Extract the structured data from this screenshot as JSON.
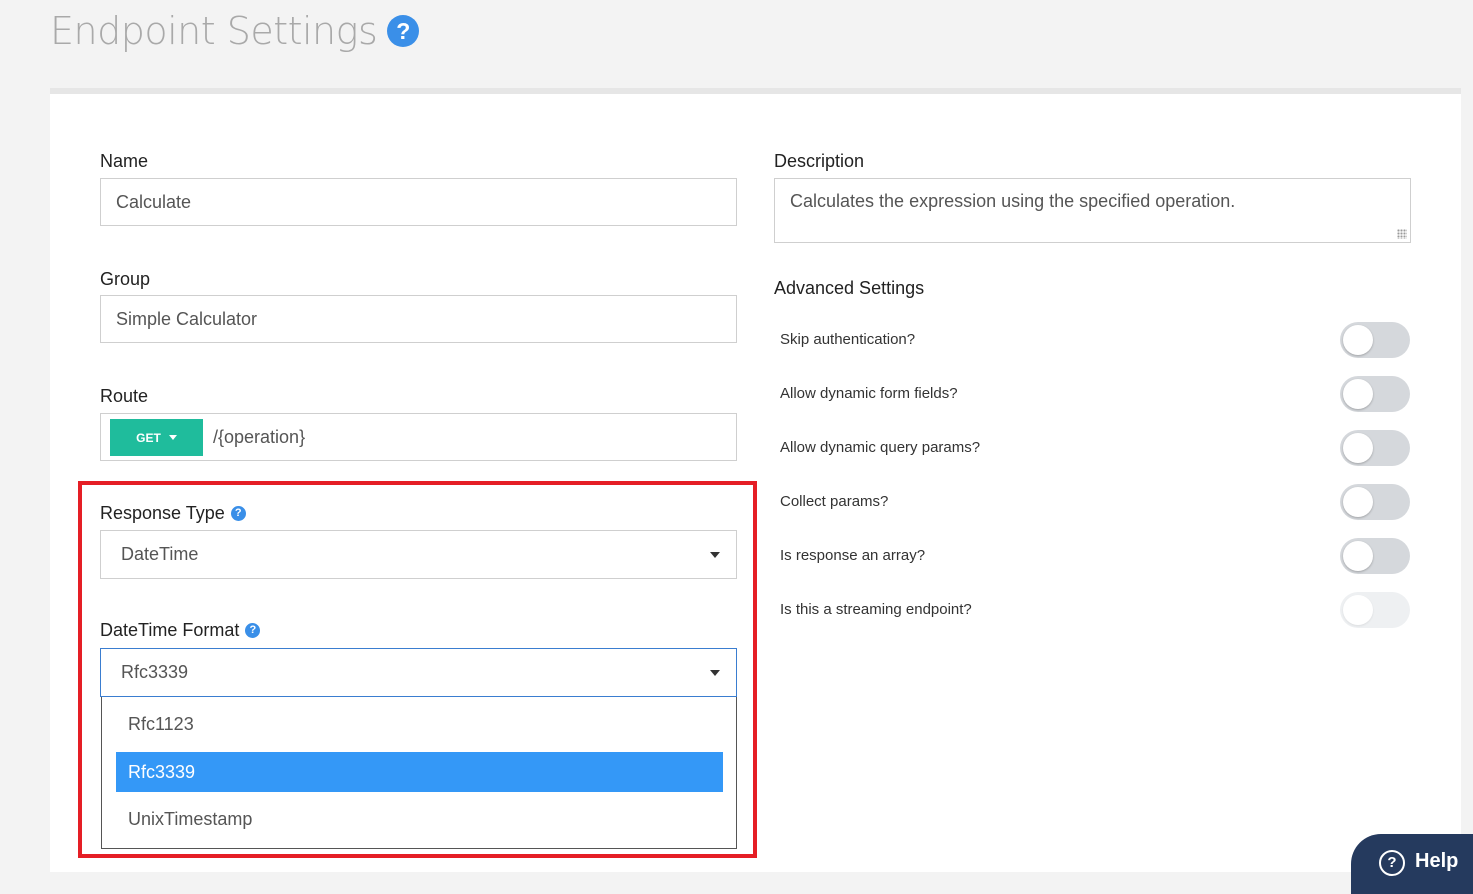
{
  "header": {
    "title": "Endpoint Settings",
    "help_icon": "?"
  },
  "form": {
    "name": {
      "label": "Name",
      "value": "Calculate"
    },
    "group": {
      "label": "Group",
      "value": "Simple Calculator"
    },
    "route": {
      "label": "Route",
      "method": "GET",
      "path": "/{operation}"
    },
    "response_type": {
      "label": "Response Type",
      "help_icon": "?",
      "value": "DateTime"
    },
    "datetime_format": {
      "label": "DateTime Format",
      "help_icon": "?",
      "value": "Rfc3339",
      "options": [
        "Rfc1123",
        "Rfc3339",
        "UnixTimestamp"
      ],
      "selected_index": 1
    },
    "description": {
      "label": "Description",
      "value": "Calculates the expression using the specified operation."
    }
  },
  "advanced": {
    "heading": "Advanced Settings",
    "settings": [
      {
        "label": "Skip authentication?",
        "on": false,
        "disabled": false
      },
      {
        "label": "Allow dynamic form fields?",
        "on": false,
        "disabled": false
      },
      {
        "label": "Allow dynamic query params?",
        "on": false,
        "disabled": false
      },
      {
        "label": "Collect params?",
        "on": false,
        "disabled": false
      },
      {
        "label": "Is response an array?",
        "on": false,
        "disabled": false
      },
      {
        "label": "Is this a streaming endpoint?",
        "on": false,
        "disabled": true
      }
    ]
  },
  "help_widget": {
    "label": "Help",
    "icon": "?"
  },
  "colors": {
    "method_button": "#1fbc9c",
    "selected_option": "#3498f7",
    "highlight_border": "#e51e25",
    "help_icon": "#3a8fe8",
    "help_widget": "#253a5e"
  }
}
